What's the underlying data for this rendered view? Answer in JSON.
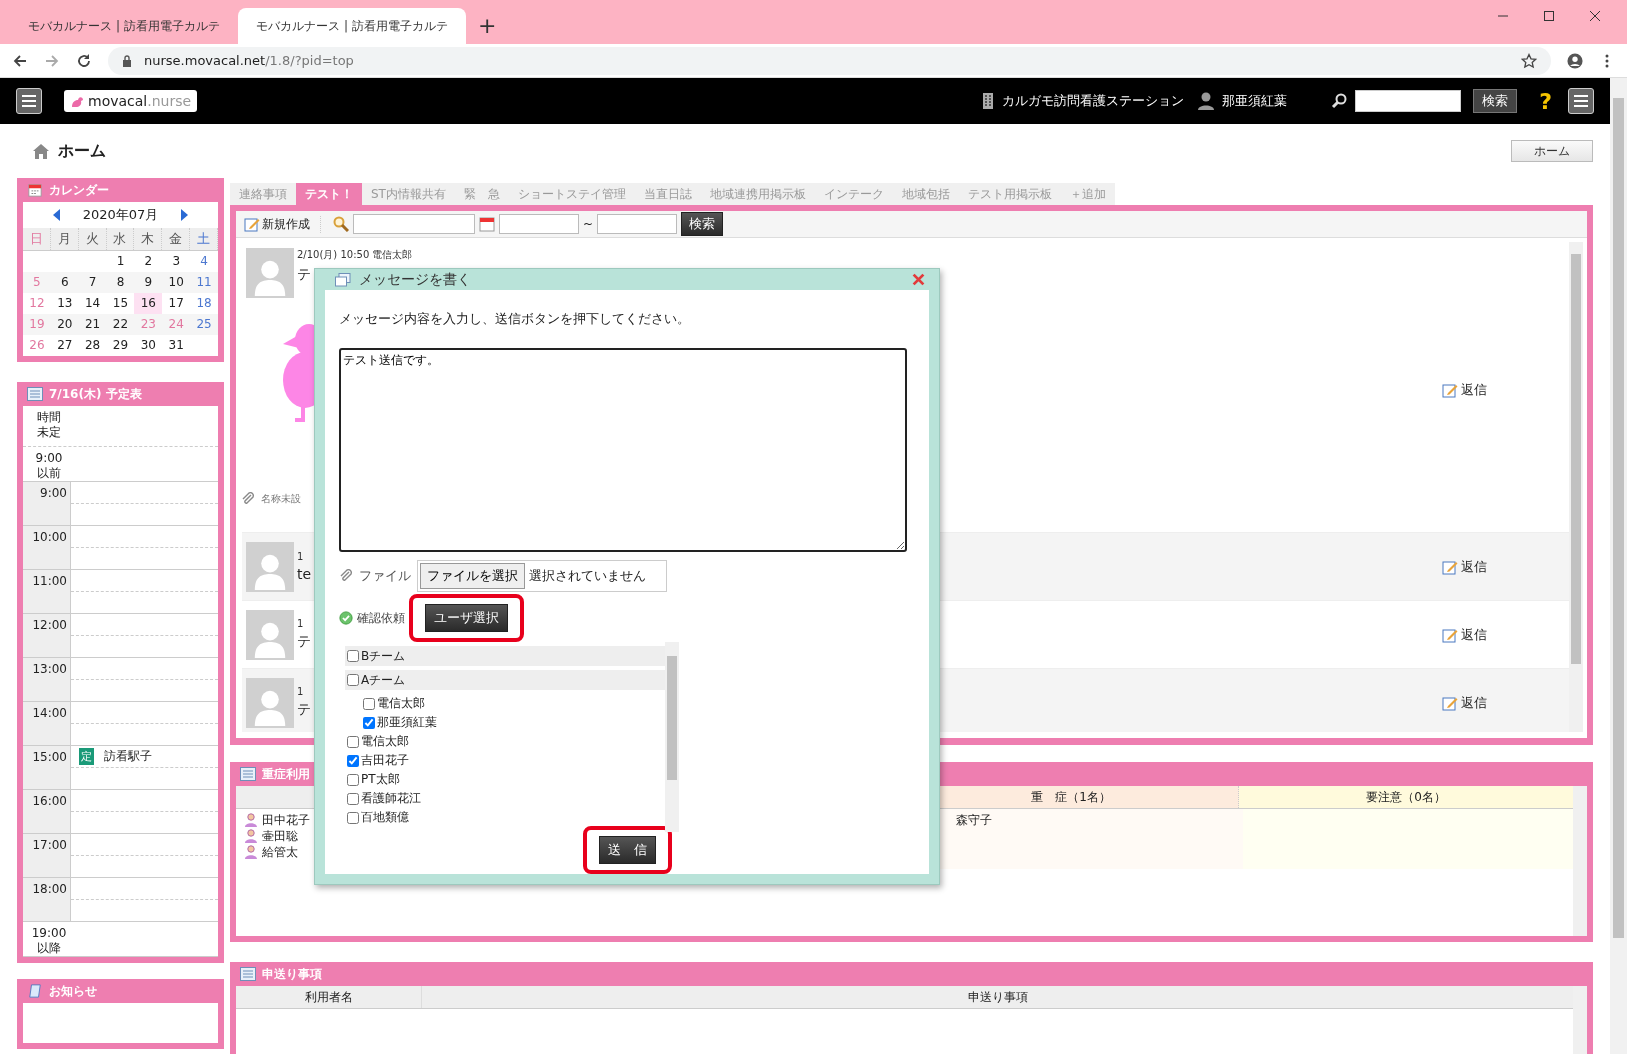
{
  "browser": {
    "tabs": [
      {
        "title": "モバカルナース | 訪看用電子カルテ",
        "selected": false
      },
      {
        "title": "モバカルナース | 訪看用電子カルテ",
        "selected": true
      }
    ],
    "new_tab": "+",
    "url_host": "nurse.movacal.net",
    "url_path": "/1.8/?pid=top"
  },
  "header": {
    "logo_name": "movacal",
    "logo_suffix": ".nurse",
    "station": "カルガモ訪問看護ステーション",
    "user": "那亜須紅葉",
    "search_button": "検索",
    "help": "?"
  },
  "page": {
    "title": "ホーム",
    "home_button": "ホーム"
  },
  "calendar": {
    "title": "カレンダー",
    "month": "2020年07月",
    "weekdays": [
      "日",
      "月",
      "火",
      "水",
      "木",
      "金",
      "土"
    ],
    "weeks": [
      [
        {
          "kind": "blank"
        },
        {
          "kind": "blank"
        },
        {
          "kind": "blank"
        },
        {
          "kind": "day",
          "n": "1",
          "holiday": false,
          "selected": false
        },
        {
          "kind": "day",
          "n": "2",
          "holiday": false,
          "selected": false
        },
        {
          "kind": "day",
          "n": "3",
          "holiday": false,
          "selected": false
        },
        {
          "kind": "day",
          "n": "4",
          "holiday": false,
          "selected": false
        }
      ],
      [
        {
          "kind": "day",
          "n": "5",
          "holiday": true,
          "selected": false
        },
        {
          "kind": "day",
          "n": "6",
          "holiday": false,
          "selected": false
        },
        {
          "kind": "day",
          "n": "7",
          "holiday": false,
          "selected": false
        },
        {
          "kind": "day",
          "n": "8",
          "holiday": false,
          "selected": false
        },
        {
          "kind": "day",
          "n": "9",
          "holiday": false,
          "selected": false
        },
        {
          "kind": "day",
          "n": "10",
          "holiday": false,
          "selected": false
        },
        {
          "kind": "day",
          "n": "11",
          "holiday": false,
          "selected": false
        }
      ],
      [
        {
          "kind": "day",
          "n": "12",
          "holiday": true,
          "selected": false
        },
        {
          "kind": "day",
          "n": "13",
          "holiday": false,
          "selected": false
        },
        {
          "kind": "day",
          "n": "14",
          "holiday": false,
          "selected": false
        },
        {
          "kind": "day",
          "n": "15",
          "holiday": false,
          "selected": false
        },
        {
          "kind": "day",
          "n": "16",
          "holiday": false,
          "selected": true
        },
        {
          "kind": "day",
          "n": "17",
          "holiday": false,
          "selected": false
        },
        {
          "kind": "day",
          "n": "18",
          "holiday": false,
          "selected": false
        }
      ],
      [
        {
          "kind": "day",
          "n": "19",
          "holiday": true,
          "selected": false
        },
        {
          "kind": "day",
          "n": "20",
          "holiday": false,
          "selected": false
        },
        {
          "kind": "day",
          "n": "21",
          "holiday": false,
          "selected": false
        },
        {
          "kind": "day",
          "n": "22",
          "holiday": false,
          "selected": false
        },
        {
          "kind": "day",
          "n": "23",
          "holiday": true,
          "selected": false
        },
        {
          "kind": "day",
          "n": "24",
          "holiday": true,
          "selected": false
        },
        {
          "kind": "day",
          "n": "25",
          "holiday": false,
          "selected": false
        }
      ],
      [
        {
          "kind": "day",
          "n": "26",
          "holiday": true,
          "selected": false
        },
        {
          "kind": "day",
          "n": "27",
          "holiday": false,
          "selected": false
        },
        {
          "kind": "day",
          "n": "28",
          "holiday": false,
          "selected": false
        },
        {
          "kind": "day",
          "n": "29",
          "holiday": false,
          "selected": false
        },
        {
          "kind": "day",
          "n": "30",
          "holiday": false,
          "selected": false
        },
        {
          "kind": "day",
          "n": "31",
          "holiday": false,
          "selected": false
        },
        {
          "kind": "blank"
        }
      ]
    ]
  },
  "schedule": {
    "title": "7/16(木) 予定表",
    "rows": [
      {
        "kind": "untimed",
        "time": "時間未定"
      },
      {
        "kind": "edge",
        "time": "9:00",
        "note": "以前"
      },
      {
        "kind": "hour",
        "time": "9:00"
      },
      {
        "kind": "hour",
        "time": "10:00"
      },
      {
        "kind": "hour",
        "time": "11:00"
      },
      {
        "kind": "hour",
        "time": "12:00"
      },
      {
        "kind": "hour",
        "time": "13:00"
      },
      {
        "kind": "hour",
        "time": "14:00"
      },
      {
        "kind": "hour",
        "time": "15:00",
        "event": {
          "badge": "定",
          "name": "訪看駅子"
        }
      },
      {
        "kind": "hour",
        "time": "16:00"
      },
      {
        "kind": "hour",
        "time": "17:00"
      },
      {
        "kind": "hour",
        "time": "18:00"
      },
      {
        "kind": "edge",
        "time": "19:00",
        "note": "以降"
      }
    ]
  },
  "notices": {
    "title": "お知らせ"
  },
  "board": {
    "tabs": [
      {
        "label": "連絡事項",
        "selected": false
      },
      {
        "label": "テスト！",
        "selected": true
      },
      {
        "label": "ST内情報共有",
        "selected": false
      },
      {
        "label": "緊　急",
        "selected": false
      },
      {
        "label": "ショートステイ管理",
        "selected": false
      },
      {
        "label": "当直日誌",
        "selected": false
      },
      {
        "label": "地域連携用掲示板",
        "selected": false
      },
      {
        "label": "インテーク",
        "selected": false
      },
      {
        "label": "地域包括",
        "selected": false
      },
      {
        "label": "テスト用掲示板",
        "selected": false
      }
    ],
    "add_tab": "＋追加",
    "new_button": "新規作成",
    "range_sep": "~",
    "search_button": "検索",
    "messages": [
      {
        "kind": "image",
        "meta": "2/10(月) 10:50 電信太郎",
        "body": "テ",
        "attachment": "名称未設",
        "reply": "返信"
      },
      {
        "kind": "text",
        "meta": "1",
        "body": "te",
        "reply": "返信"
      },
      {
        "kind": "text",
        "meta": "1",
        "body": "テ",
        "reply": "返信"
      },
      {
        "kind": "text",
        "meta": "1",
        "body": "テ",
        "reply": "返信"
      }
    ]
  },
  "severe": {
    "title": "重症利用",
    "columns": [
      "重　症（1名）",
      "要注意（0名）"
    ],
    "names": [
      "田中花子",
      "壷田聡",
      "給管太"
    ],
    "severe_names": [
      "森守子"
    ]
  },
  "handover": {
    "title": "申送り事項",
    "columns": [
      "利用者名",
      "申送り事項"
    ]
  },
  "dialog": {
    "title": "メッセージを書く",
    "instruction": "メッセージ内容を入力し、送信ボタンを押下してください。",
    "message": "テスト送信です。",
    "file_label": "ファイル",
    "file_button": "ファイルを選択",
    "file_status": "選択されていません",
    "confirm_label": "確認依頼",
    "user_select": {
      "label": "ユーザ選択",
      "highlighted": true
    },
    "recipients": [
      {
        "kind": "group",
        "label": "Bチーム",
        "checked": false
      },
      {
        "kind": "group",
        "label": "Aチーム",
        "checked": false,
        "children": [
          {
            "label": "電信太郎",
            "checked": false
          },
          {
            "label": "那亜須紅葉",
            "checked": true
          }
        ]
      },
      {
        "kind": "user",
        "label": "電信太郎",
        "checked": false
      },
      {
        "kind": "user",
        "label": "吉田花子",
        "checked": true
      },
      {
        "kind": "user",
        "label": "PT太郎",
        "checked": false
      },
      {
        "kind": "user",
        "label": "看護師花江",
        "checked": false
      },
      {
        "kind": "user",
        "label": "百地類億",
        "checked": false
      }
    ],
    "send": {
      "label": "送　信",
      "highlighted": true
    }
  }
}
